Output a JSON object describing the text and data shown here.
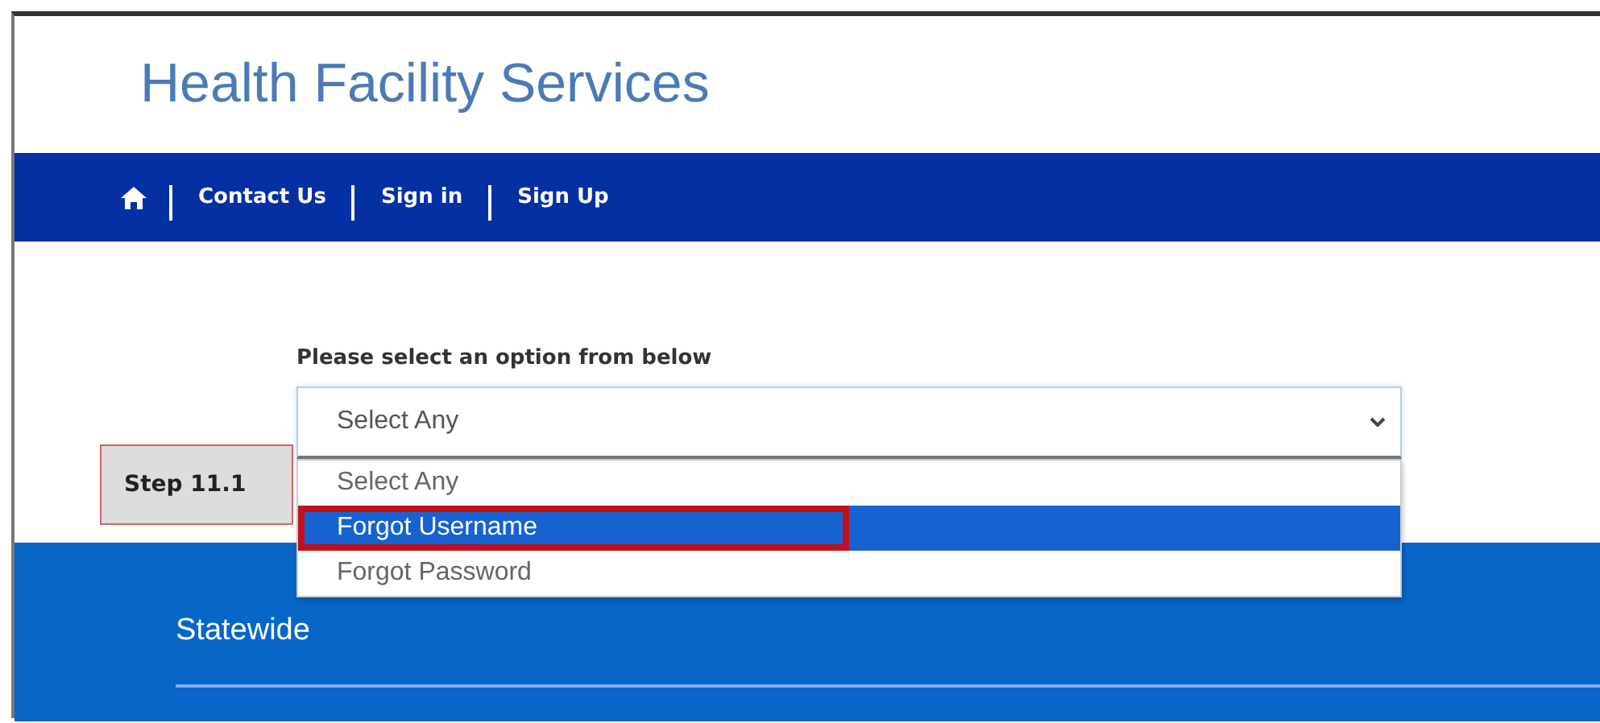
{
  "header": {
    "title": "Health Facility Services"
  },
  "nav": {
    "links": [
      {
        "label": "Contact Us"
      },
      {
        "label": "Sign in"
      },
      {
        "label": "Sign Up"
      }
    ]
  },
  "form": {
    "label": "Please select an option from below",
    "select": {
      "value": "Select Any",
      "expanded": true
    },
    "options": [
      {
        "label": "Select Any",
        "selected": false
      },
      {
        "label": "Forgot Username",
        "selected": true
      },
      {
        "label": "Forgot Password",
        "selected": false
      }
    ]
  },
  "callout": {
    "label": "Step 11.1"
  },
  "band": {
    "title": "Statewide"
  }
}
